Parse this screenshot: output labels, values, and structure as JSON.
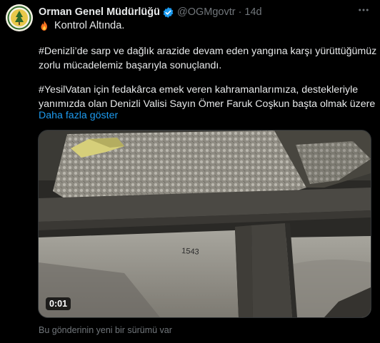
{
  "author": {
    "display_name": "Orman Genel Müdürlüğü",
    "handle": "@OGMgovtr",
    "separator": "·",
    "time": "14d",
    "avatar_icon": "ogm-logo",
    "verified_icon": "verified-badge-icon",
    "verified_color": "#1d9bf0"
  },
  "status": {
    "icon": "fire-icon",
    "text": "Kontrol Altında."
  },
  "tweet": {
    "paragraph1_line1": "#Denizli’de sarp ve dağlık arazide devam eden yangına karşı yürüttüğümüz",
    "paragraph1_line2": "zorlu mücadelemiz başarıyla sonuçlandı.",
    "paragraph2_line1": "#YesilVatan için fedakârca emek veren kahramanlarımıza, destekleriyle",
    "paragraph2_line2": "yanımızda olan Denizli Valisi Sayın Ömer Faruk Coşkun başta olmak üzere",
    "show_more": "Daha fazla göster"
  },
  "media": {
    "type": "video",
    "duration": "0:01",
    "cockpit_marking": "1543"
  },
  "footer": {
    "note": "Bu gönderinin yeni bir sürümü var"
  },
  "colors": {
    "background": "#000000",
    "text": "#e7e9ea",
    "muted": "#71767b",
    "link": "#1d9bf0"
  }
}
